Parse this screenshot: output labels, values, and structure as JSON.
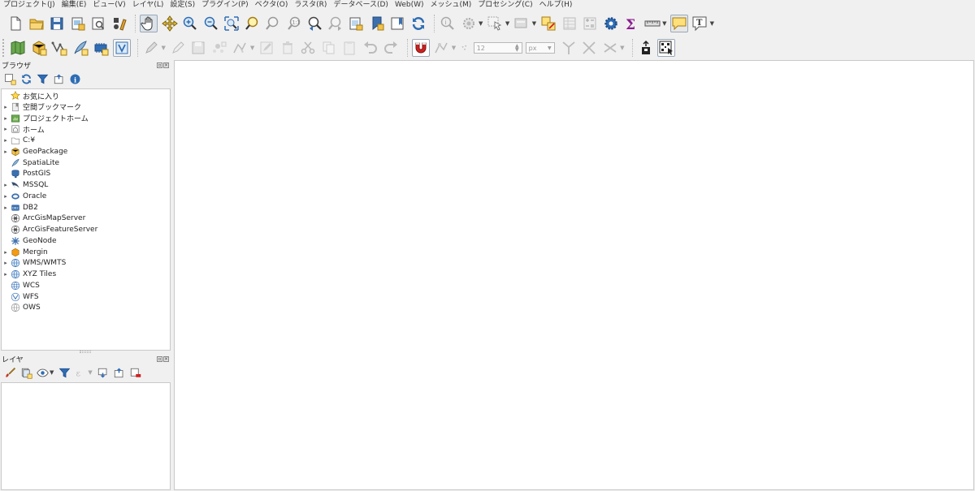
{
  "menu": [
    "プロジェクト(J)",
    "編集(E)",
    "ビュー(V)",
    "レイヤ(L)",
    "設定(S)",
    "プラグイン(P)",
    "ベクタ(O)",
    "ラスタ(R)",
    "データベース(D)",
    "Web(W)",
    "メッシュ(M)",
    "プロセシング(C)",
    "ヘルプ(H)"
  ],
  "digitize": {
    "tolerance_value": "12",
    "units": "px"
  },
  "browser_panel": {
    "title": "ブラウザ",
    "items": [
      {
        "label": "お気に入り",
        "icon": "star-icon",
        "expandable": false
      },
      {
        "label": "空間ブックマーク",
        "icon": "bookmark-icon",
        "expandable": true
      },
      {
        "label": "プロジェクトホーム",
        "icon": "project-home-icon",
        "expandable": true
      },
      {
        "label": "ホーム",
        "icon": "home-icon",
        "expandable": true
      },
      {
        "label": "C:¥",
        "icon": "folder-icon",
        "expandable": true
      },
      {
        "label": "GeoPackage",
        "icon": "geopackage-icon",
        "expandable": true
      },
      {
        "label": "SpatiaLite",
        "icon": "spatialite-icon",
        "expandable": false
      },
      {
        "label": "PostGIS",
        "icon": "postgis-elephant-icon",
        "expandable": false
      },
      {
        "label": "MSSQL",
        "icon": "mssql-icon",
        "expandable": true
      },
      {
        "label": "Oracle",
        "icon": "oracle-icon",
        "expandable": true
      },
      {
        "label": "DB2",
        "icon": "db2-icon",
        "expandable": true
      },
      {
        "label": "ArcGisMapServer",
        "icon": "arcgis-globe-icon",
        "expandable": false
      },
      {
        "label": "ArcGisFeatureServer",
        "icon": "arcgis-globe-icon",
        "expandable": false
      },
      {
        "label": "GeoNode",
        "icon": "geonode-icon",
        "expandable": false
      },
      {
        "label": "Mergin",
        "icon": "mergin-icon",
        "expandable": true
      },
      {
        "label": "WMS/WMTS",
        "icon": "wms-globe-icon",
        "expandable": true
      },
      {
        "label": "XYZ Tiles",
        "icon": "xyz-globe-icon",
        "expandable": true
      },
      {
        "label": "WCS",
        "icon": "wcs-globe-icon",
        "expandable": false
      },
      {
        "label": "WFS",
        "icon": "wfs-globe-icon",
        "expandable": false
      },
      {
        "label": "OWS",
        "icon": "ows-globe-icon",
        "expandable": false
      }
    ]
  },
  "layers_panel": {
    "title": "レイヤ"
  },
  "colors": {
    "accent_blue": "#2f6db5",
    "highlight_yellow": "#ffe07a",
    "sigma_purple": "#8a1d8f"
  }
}
